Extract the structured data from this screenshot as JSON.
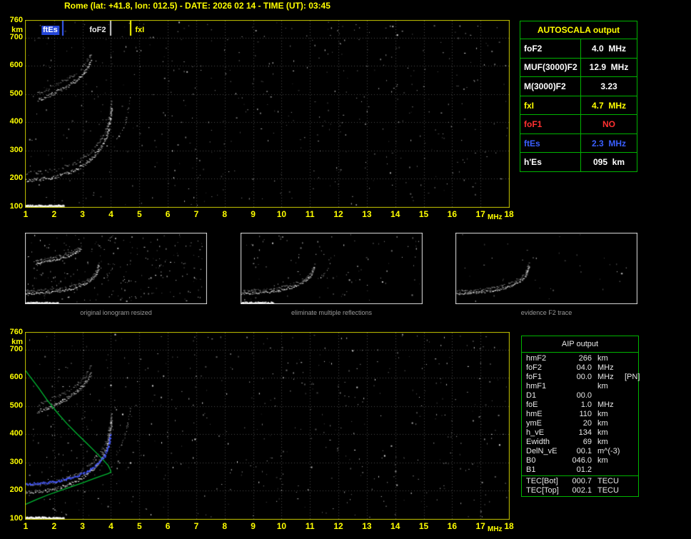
{
  "header": {
    "title": "Rome (lat: +41.8, lon: 012.5) - DATE: 2026 02 14 - TIME (UT): 03:45"
  },
  "colors": {
    "accent_yellow": "#ffff00",
    "plot_border": "#c8c800",
    "grid_gray": "#969696",
    "table_green": "#00b400",
    "marker_blue": "#3a5fff",
    "status_red": "#ff3030",
    "profile_green": "#00bb33",
    "fitted_blue": "#3c50ff",
    "thumb_border": "#e0e0e0",
    "caption_gray": "#9a9a9a"
  },
  "autoscala": {
    "title": "AUTOSCALA output",
    "rows": [
      {
        "label": "foF2",
        "value": "4.0",
        "unit": "MHz",
        "color": "#ffffff"
      },
      {
        "label": "MUF(3000)F2",
        "value": "12.9",
        "unit": "MHz",
        "color": "#ffffff"
      },
      {
        "label": "M(3000)F2",
        "value": "3.23",
        "unit": "",
        "color": "#ffffff"
      },
      {
        "label": "fxI",
        "value": "4.7",
        "unit": "MHz",
        "color": "#ffff00"
      },
      {
        "label": "foF1",
        "value": "NO",
        "unit": "",
        "color": "#ff3030"
      },
      {
        "label": "ftEs",
        "value": "2.3",
        "unit": "MHz",
        "color": "#3a5fff"
      },
      {
        "label": "h'Es",
        "value": "095",
        "unit": "km",
        "color": "#ffffff"
      }
    ]
  },
  "aip": {
    "title": "AIP output",
    "rows": [
      {
        "label": "hmF2",
        "value": "266",
        "unit": "km",
        "note": ""
      },
      {
        "label": "foF2",
        "value": "04.0",
        "unit": "MHz",
        "note": ""
      },
      {
        "label": "foF1",
        "value": "00.0",
        "unit": "MHz",
        "note": "[PN]"
      },
      {
        "label": "hmF1",
        "value": "",
        "unit": "km",
        "note": ""
      },
      {
        "label": "D1",
        "value": "00.0",
        "unit": "",
        "note": ""
      },
      {
        "label": "foE",
        "value": "1.0",
        "unit": "MHz",
        "note": ""
      },
      {
        "label": "hmE",
        "value": "110",
        "unit": "km",
        "note": ""
      },
      {
        "label": "ymE",
        "value": "20",
        "unit": "km",
        "note": ""
      },
      {
        "label": "h_vE",
        "value": "134",
        "unit": "km",
        "note": ""
      },
      {
        "label": "Ewidth",
        "value": "69",
        "unit": "km",
        "note": ""
      },
      {
        "label": "DelN_vE",
        "value": "00.1",
        "unit": "m^(-3)",
        "note": ""
      },
      {
        "label": "B0",
        "value": "046.0",
        "unit": "km",
        "note": ""
      },
      {
        "label": "B1",
        "value": "01.2",
        "unit": "",
        "note": ""
      }
    ],
    "tec_rows": [
      {
        "label": "TEC[Bot]",
        "value": "000.7",
        "unit": "TECU",
        "note": ""
      },
      {
        "label": "TEC[Top]",
        "value": "002.1",
        "unit": "TECU",
        "note": ""
      }
    ]
  },
  "thumbnails": [
    {
      "caption": "original ionogram resized",
      "include_traces": [
        "Es-layer",
        "F2-first-hop",
        "F2-second-hop",
        "F2-extraordinary"
      ],
      "noise_dots": 230
    },
    {
      "caption": "eliminate multiple reflections",
      "include_traces": [
        "Es-layer",
        "F2-first-hop",
        "F2-extraordinary"
      ],
      "noise_dots": 100
    },
    {
      "caption": "evidence F2 trace",
      "include_traces": [
        "F2-first-hop"
      ],
      "noise_dots": 40
    }
  ],
  "chart_data": [
    {
      "name": "autoscaled_ionogram",
      "type": "scatter",
      "xlabel": "MHz",
      "ylabel": "km",
      "xlim": [
        1,
        18
      ],
      "ylim": [
        100,
        760
      ],
      "grid": true,
      "x_ticks": [
        1,
        2,
        3,
        4,
        5,
        6,
        7,
        8,
        9,
        10,
        11,
        12,
        13,
        14,
        15,
        16,
        17,
        18
      ],
      "y_ticks": [
        760,
        700,
        600,
        500,
        400,
        300,
        200,
        100
      ],
      "markers": [
        {
          "name": "ftEs",
          "f": 2.3,
          "color": "#3a5fff",
          "label_side": "left",
          "chip": true
        },
        {
          "name": "foF2",
          "f": 4.0,
          "color": "#cfcfcf",
          "label_side": "left",
          "chip": false
        },
        {
          "name": "fxI",
          "f": 4.7,
          "color": "#ffff00",
          "label_side": "right",
          "chip": false
        }
      ],
      "traces": [
        {
          "name": "Es-layer",
          "style": "thick",
          "points": [
            [
              1.0,
              104
            ],
            [
              2.35,
              104
            ]
          ]
        },
        {
          "name": "F2-first-hop",
          "style": "dense",
          "points": [
            [
              1.0,
              195
            ],
            [
              1.6,
              200
            ],
            [
              2.2,
              212
            ],
            [
              2.7,
              230
            ],
            [
              3.1,
              255
            ],
            [
              3.4,
              283
            ],
            [
              3.65,
              315
            ],
            [
              3.85,
              355
            ],
            [
              3.95,
              405
            ],
            [
              4.02,
              455
            ]
          ]
        },
        {
          "name": "F2-second-hop",
          "style": "dense",
          "points": [
            [
              1.4,
              480
            ],
            [
              1.9,
              500
            ],
            [
              2.4,
              525
            ],
            [
              2.8,
              552
            ],
            [
              3.1,
              585
            ],
            [
              3.3,
              620
            ]
          ]
        },
        {
          "name": "F2-extraordinary",
          "style": "sparse",
          "points": [
            [
              4.15,
              330
            ],
            [
              4.35,
              360
            ],
            [
              4.5,
              400
            ],
            [
              4.6,
              445
            ],
            [
              4.68,
              495
            ]
          ]
        }
      ],
      "noise_dots": 470
    },
    {
      "name": "aip_profile_ionogram",
      "type": "scatter",
      "xlabel": "MHz",
      "ylabel": "km",
      "xlim": [
        1,
        18
      ],
      "ylim": [
        100,
        760
      ],
      "grid": true,
      "x_ticks": [
        1,
        2,
        3,
        4,
        5,
        6,
        7,
        8,
        9,
        10,
        11,
        12,
        13,
        14,
        15,
        16,
        17,
        18
      ],
      "y_ticks": [
        760,
        700,
        600,
        500,
        400,
        300,
        200,
        100
      ],
      "traces": [
        {
          "name": "Es-layer",
          "style": "thick",
          "points": [
            [
              1.0,
              104
            ],
            [
              2.35,
              104
            ]
          ]
        },
        {
          "name": "F2-first-hop",
          "style": "dense",
          "points": [
            [
              1.0,
              195
            ],
            [
              1.6,
              200
            ],
            [
              2.2,
              212
            ],
            [
              2.7,
              230
            ],
            [
              3.1,
              255
            ],
            [
              3.4,
              283
            ],
            [
              3.65,
              315
            ],
            [
              3.85,
              355
            ],
            [
              3.95,
              405
            ],
            [
              4.02,
              455
            ]
          ]
        },
        {
          "name": "F2-second-hop",
          "style": "dense",
          "points": [
            [
              1.4,
              480
            ],
            [
              1.9,
              500
            ],
            [
              2.4,
              525
            ],
            [
              2.8,
              552
            ],
            [
              3.1,
              585
            ],
            [
              3.3,
              620
            ]
          ]
        },
        {
          "name": "F2-extraordinary",
          "style": "sparse",
          "points": [
            [
              4.15,
              330
            ],
            [
              4.35,
              360
            ],
            [
              4.5,
              400
            ],
            [
              4.6,
              445
            ],
            [
              4.68,
              495
            ]
          ]
        }
      ],
      "profile": {
        "name": "electron-density-profile",
        "color": "#00bb33",
        "points": [
          [
            1.0,
            152
          ],
          [
            1.4,
            170
          ],
          [
            1.8,
            186
          ],
          [
            2.2,
            200
          ],
          [
            2.6,
            214
          ],
          [
            3.0,
            228
          ],
          [
            3.4,
            243
          ],
          [
            3.7,
            254
          ],
          [
            3.9,
            261
          ],
          [
            4.0,
            266
          ],
          [
            3.97,
            276
          ],
          [
            3.9,
            290
          ],
          [
            3.7,
            312
          ],
          [
            3.45,
            338
          ],
          [
            3.15,
            368
          ],
          [
            2.8,
            402
          ],
          [
            2.45,
            438
          ],
          [
            2.1,
            478
          ],
          [
            1.75,
            522
          ],
          [
            1.45,
            565
          ],
          [
            1.15,
            605
          ],
          [
            1.0,
            625
          ]
        ]
      },
      "fitted_trace": {
        "name": "autoscala-F2-trace-fit",
        "color": "#3c50ff",
        "points": [
          [
            1.0,
            225
          ],
          [
            1.7,
            230
          ],
          [
            2.3,
            240
          ],
          [
            2.8,
            254
          ],
          [
            3.2,
            272
          ],
          [
            3.5,
            295
          ],
          [
            3.75,
            325
          ],
          [
            3.9,
            360
          ],
          [
            3.98,
            400
          ]
        ]
      },
      "noise_dots": 500
    }
  ]
}
